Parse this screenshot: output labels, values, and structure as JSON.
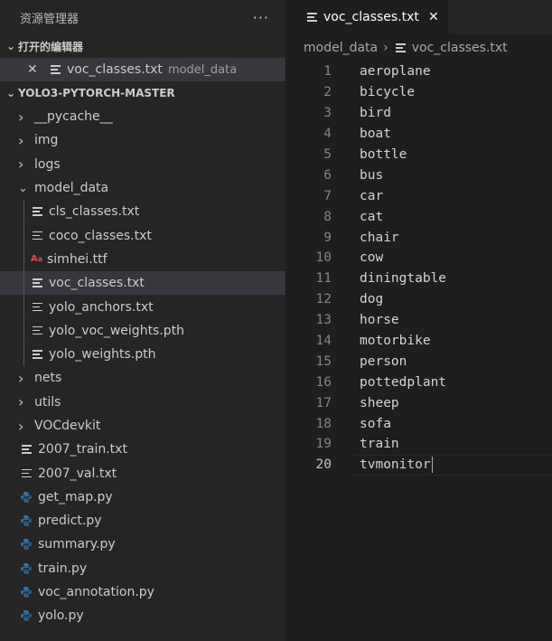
{
  "explorer": {
    "title": "资源管理器",
    "more": "···",
    "open_editors_label": "打开的编辑器",
    "open_editor": {
      "name": "voc_classes.txt",
      "description": "model_data"
    },
    "project_label": "YOLO3-PYTORCH-MASTER",
    "tree": [
      {
        "label": "__pycache__",
        "kind": "folder-collapsed",
        "indent": 0
      },
      {
        "label": "img",
        "kind": "folder-collapsed",
        "indent": 0
      },
      {
        "label": "logs",
        "kind": "folder-collapsed",
        "indent": 0
      },
      {
        "label": "model_data",
        "kind": "folder-expanded",
        "indent": 0
      },
      {
        "label": "cls_classes.txt",
        "kind": "txt",
        "indent": 1
      },
      {
        "label": "coco_classes.txt",
        "kind": "txt",
        "indent": 1
      },
      {
        "label": "simhei.ttf",
        "kind": "ttf",
        "indent": 1
      },
      {
        "label": "voc_classes.txt",
        "kind": "txt",
        "indent": 1,
        "active": true
      },
      {
        "label": "yolo_anchors.txt",
        "kind": "txt",
        "indent": 1
      },
      {
        "label": "yolo_voc_weights.pth",
        "kind": "txt",
        "indent": 1
      },
      {
        "label": "yolo_weights.pth",
        "kind": "txt",
        "indent": 1
      },
      {
        "label": "nets",
        "kind": "folder-collapsed",
        "indent": 0
      },
      {
        "label": "utils",
        "kind": "folder-collapsed",
        "indent": 0
      },
      {
        "label": "VOCdevkit",
        "kind": "folder-collapsed",
        "indent": 0
      },
      {
        "label": "2007_train.txt",
        "kind": "txt",
        "indent": 0
      },
      {
        "label": "2007_val.txt",
        "kind": "txt",
        "indent": 0
      },
      {
        "label": "get_map.py",
        "kind": "py",
        "indent": 0
      },
      {
        "label": "predict.py",
        "kind": "py",
        "indent": 0
      },
      {
        "label": "summary.py",
        "kind": "py",
        "indent": 0
      },
      {
        "label": "train.py",
        "kind": "py",
        "indent": 0
      },
      {
        "label": "voc_annotation.py",
        "kind": "py",
        "indent": 0
      },
      {
        "label": "yolo.py",
        "kind": "py",
        "indent": 0
      }
    ]
  },
  "editor": {
    "tab_label": "voc_classes.txt",
    "breadcrumb": {
      "folder": "model_data",
      "file": "voc_classes.txt"
    },
    "current_line": 20,
    "lines": [
      "aeroplane",
      "bicycle",
      "bird",
      "boat",
      "bottle",
      "bus",
      "car",
      "cat",
      "chair",
      "cow",
      "diningtable",
      "dog",
      "horse",
      "motorbike",
      "person",
      "pottedplant",
      "sheep",
      "sofa",
      "train",
      "tvmonitor"
    ]
  },
  "colors": {
    "sidebar_bg": "#252526",
    "editor_bg": "#1e1e1e",
    "active_row": "#37373d",
    "python_blue": "#3572a5",
    "python_yellow": "#ffd43b"
  }
}
